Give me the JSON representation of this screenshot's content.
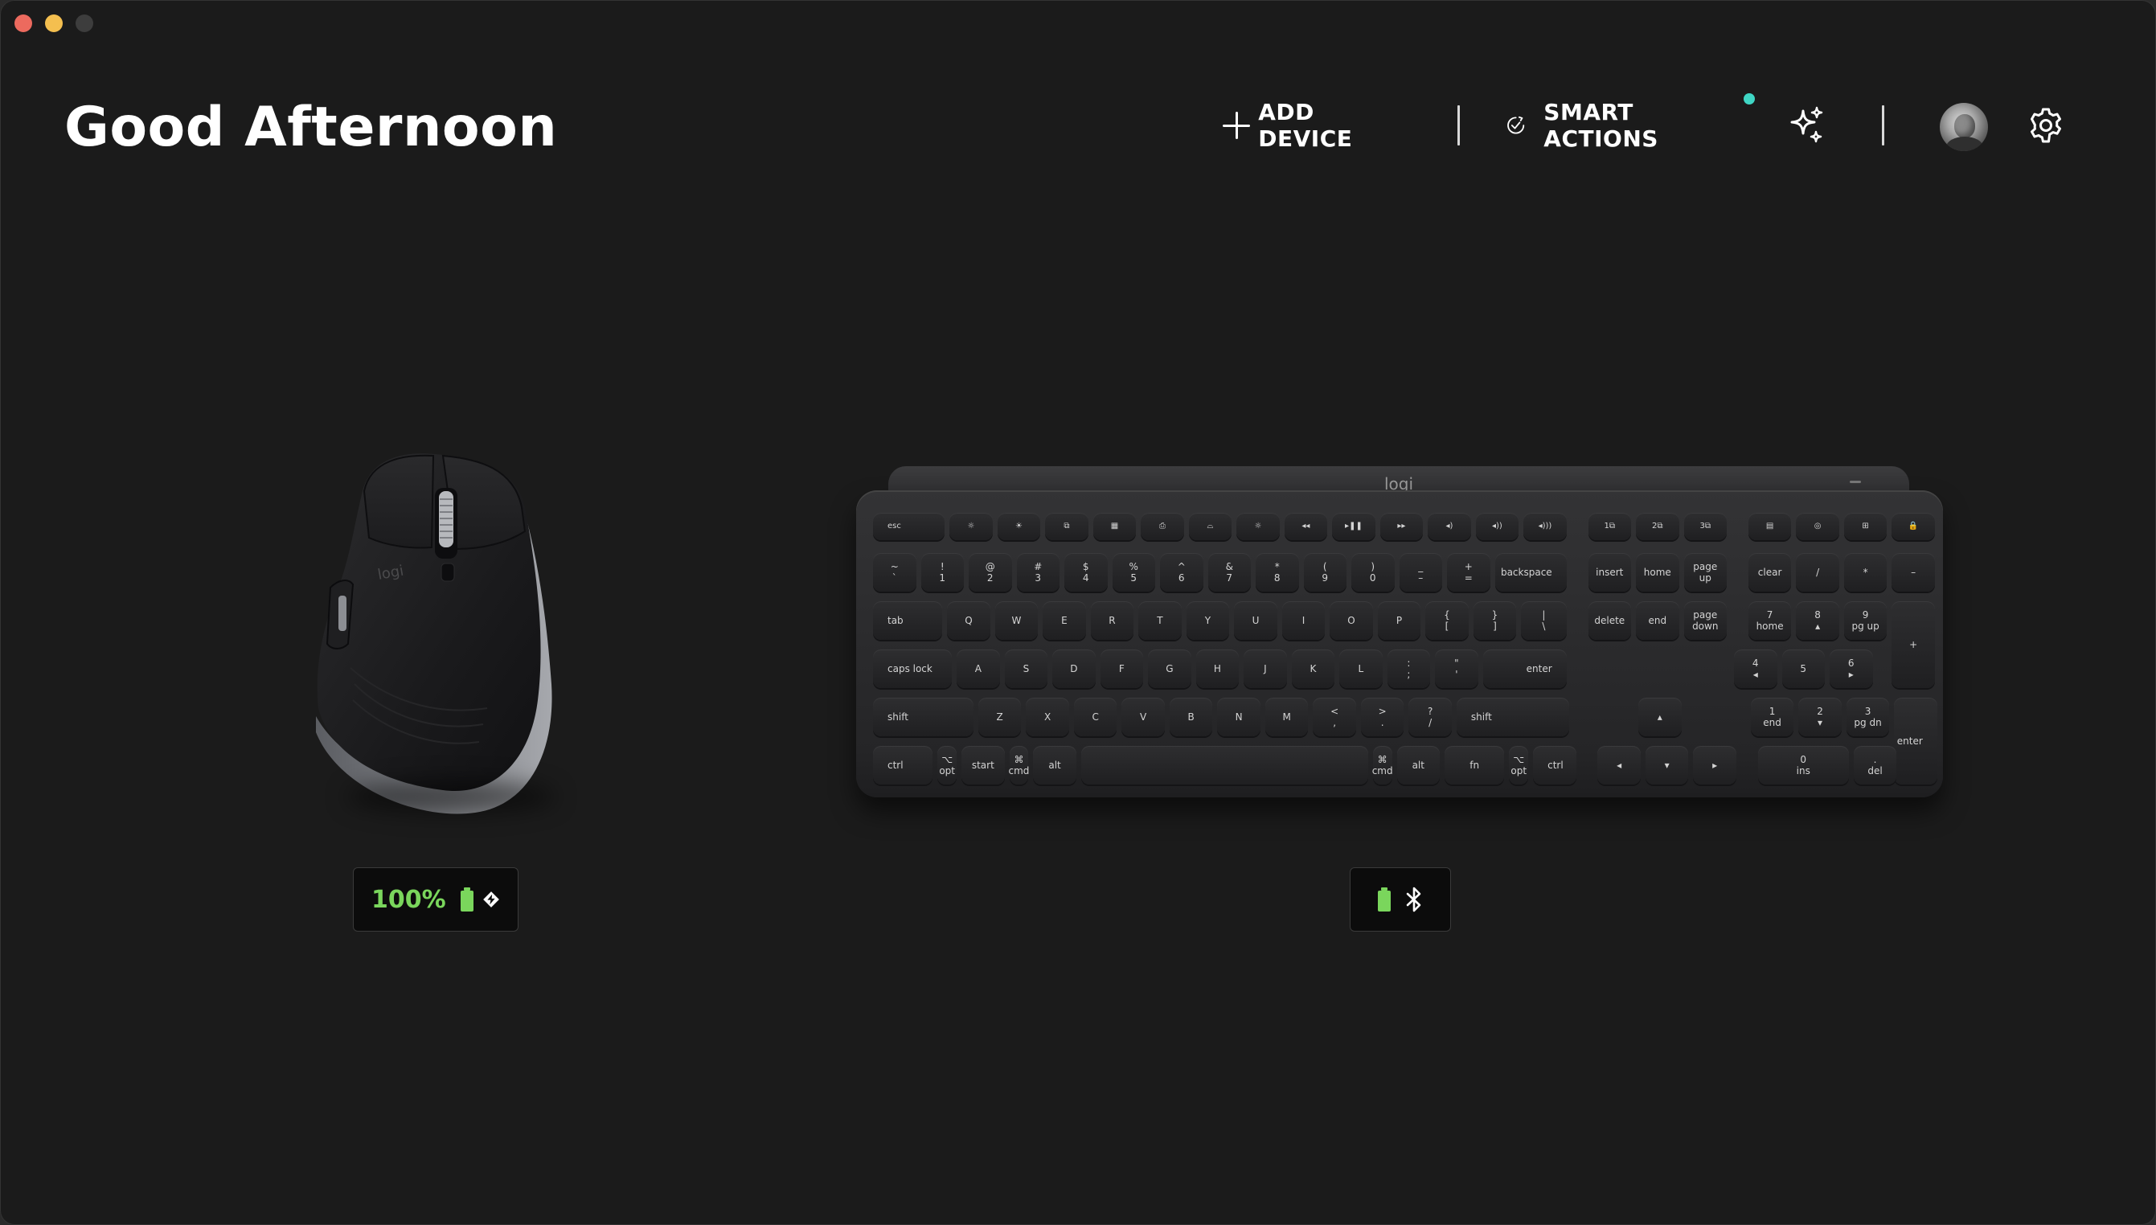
{
  "window": {
    "controls": [
      "close",
      "minimize",
      "maximize"
    ]
  },
  "header": {
    "greeting": "Good Afternoon",
    "add_device_label": "ADD DEVICE",
    "smart_actions_label": "SMART ACTIONS",
    "notification_color": "#3fd6c4"
  },
  "devices": {
    "mouse": {
      "brand_mark": "logi",
      "battery_percent": "100%",
      "battery_color": "#7ad65c",
      "connection": "logi-bolt-icon"
    },
    "keyboard": {
      "brand_mark": "logi",
      "battery_color": "#7ad65c",
      "connection": "bluetooth-icon"
    }
  },
  "keyboard_keys": {
    "fn_row": [
      "esc",
      "☼",
      "☀",
      "⧉",
      "▦",
      "⎙",
      "⌓",
      "☼",
      "◂◂",
      "▸❚❚",
      "▸▸",
      "◂)",
      "◂))",
      "◂)))",
      "1⧉",
      "2⧉",
      "3⧉",
      "▤",
      "◎",
      "⊞",
      "🔒"
    ],
    "row1": [
      "~\n`",
      "!\n1",
      "@\n2",
      "#\n3",
      "$\n4",
      "%\n5",
      "^\n6",
      "&\n7",
      "*\n8",
      "(\n9",
      ")\n0",
      "_\n–",
      "+\n=",
      "backspace",
      "insert",
      "home",
      "page\nup",
      "clear",
      "/",
      "*",
      "–"
    ],
    "row2": [
      "tab",
      "Q",
      "W",
      "E",
      "R",
      "T",
      "Y",
      "U",
      "I",
      "O",
      "P",
      "{\n[",
      "}\n]",
      "|\n\\",
      "delete",
      "end",
      "page\ndown",
      "7\nhome",
      "8\n▴",
      "9\npg up",
      "+"
    ],
    "row3": [
      "caps lock",
      "A",
      "S",
      "D",
      "F",
      "G",
      "H",
      "J",
      "K",
      "L",
      ":\n;",
      "\"\n'",
      "enter",
      "4\n◂",
      "5",
      "6\n▸"
    ],
    "row4": [
      "shift",
      "Z",
      "X",
      "C",
      "V",
      "B",
      "N",
      "M",
      "<\n,",
      ">\n.",
      "?\n/",
      "shift",
      "▴",
      "1\nend",
      "2\n▾",
      "3\npg dn",
      "enter"
    ],
    "row5": [
      "ctrl",
      "⌥\nopt",
      "start",
      "⌘\ncmd",
      "alt",
      "",
      "⌘\ncmd",
      "alt",
      "fn",
      "⌥\nopt",
      "ctrl",
      "◂",
      "▾",
      "▸",
      "0\nins",
      ".\ndel",
      "="
    ]
  }
}
